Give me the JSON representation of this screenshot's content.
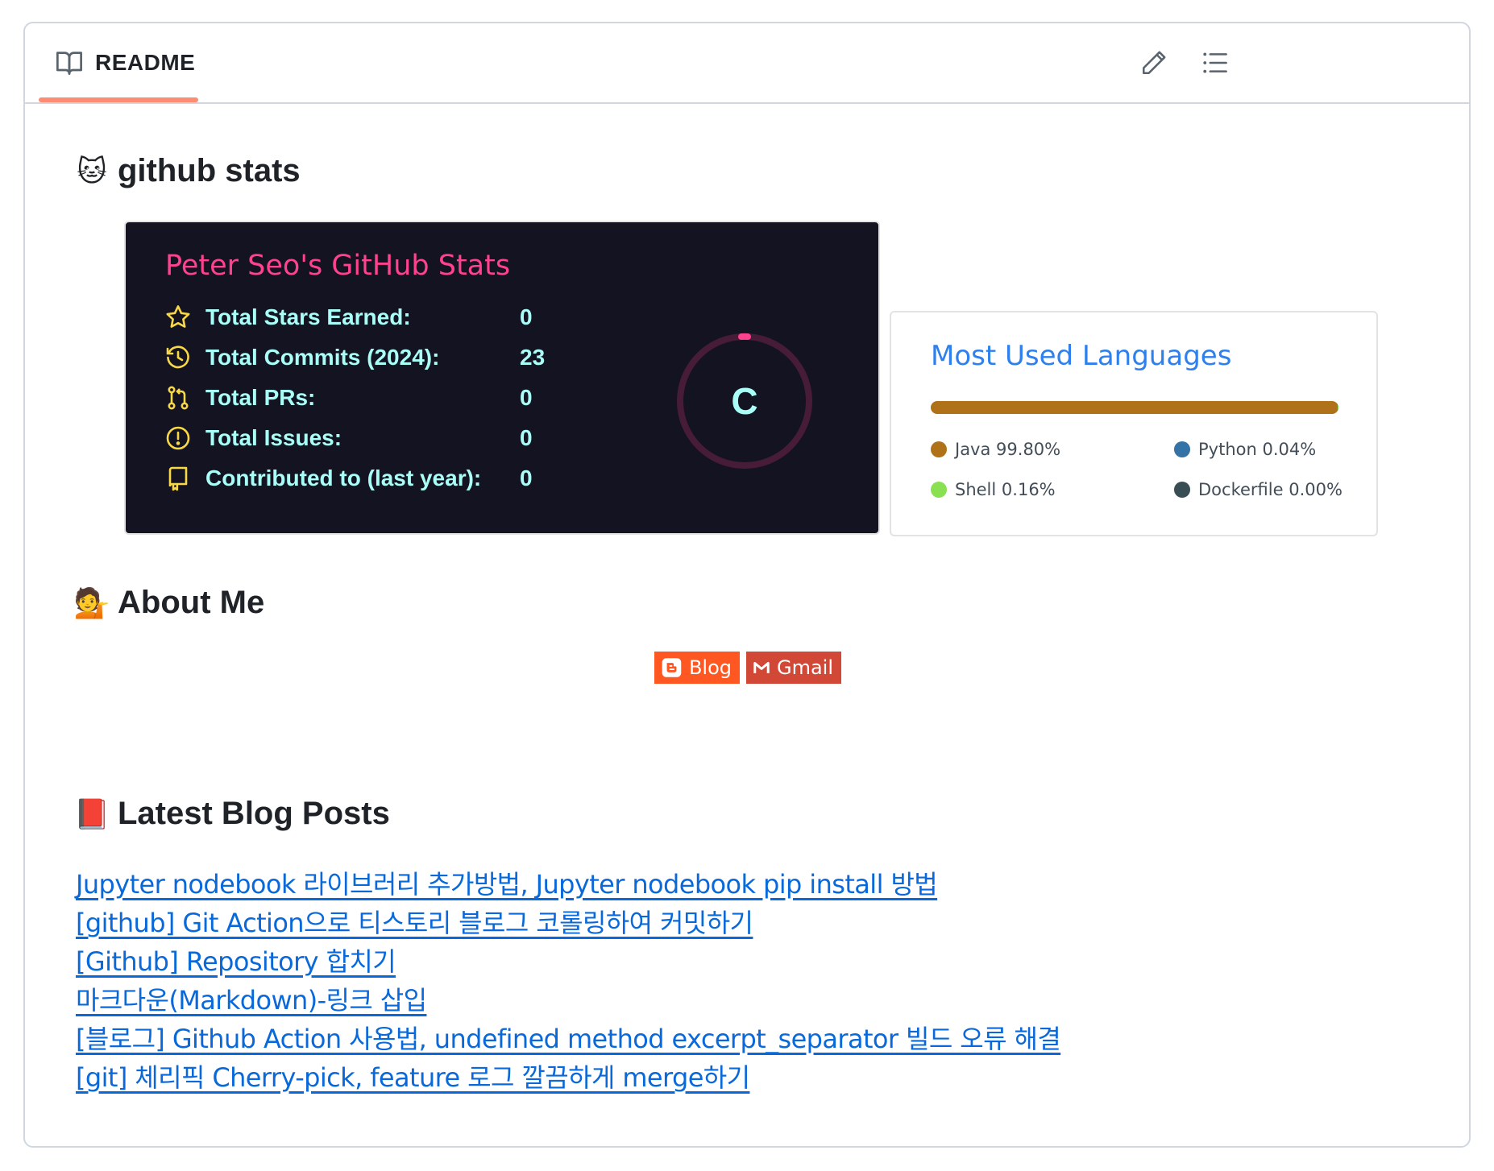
{
  "readme": {
    "tab_label": "README",
    "edit_icon": "pencil-icon",
    "outline_icon": "list-unordered-icon"
  },
  "sections": {
    "github_stats": {
      "emoji": "🐱",
      "title": "github stats"
    },
    "about_me": {
      "emoji": "💁",
      "title": "About Me"
    },
    "blog_posts": {
      "emoji": "📕",
      "title": "Latest Blog Posts"
    }
  },
  "stats_card": {
    "title": "Peter Seo's GitHub Stats",
    "rows": [
      {
        "icon": "star-icon",
        "label": "Total Stars Earned:",
        "value": "0"
      },
      {
        "icon": "history-icon",
        "label": "Total Commits (2024):",
        "value": "23"
      },
      {
        "icon": "pull-request-icon",
        "label": "Total PRs:",
        "value": "0"
      },
      {
        "icon": "issue-icon",
        "label": "Total Issues:",
        "value": "0"
      },
      {
        "icon": "repo-icon",
        "label": "Contributed to (last year):",
        "value": "0"
      }
    ],
    "rank": "C",
    "colors": {
      "bg": "#141321",
      "title": "#fe428e",
      "text": "#a9fef7",
      "icon": "#f8d847",
      "ring": "#fe428e"
    }
  },
  "languages_card": {
    "title": "Most Used Languages",
    "languages": [
      {
        "name": "Java",
        "percent": "99.80%",
        "share": 99.8,
        "color": "#b07219"
      },
      {
        "name": "Python",
        "percent": "0.04%",
        "share": 0.04,
        "color": "#3572A5"
      },
      {
        "name": "Shell",
        "percent": "0.16%",
        "share": 0.16,
        "color": "#89e051"
      },
      {
        "name": "Dockerfile",
        "percent": "0.00%",
        "share": 0.0,
        "color": "#384d54"
      }
    ]
  },
  "badges": [
    {
      "label": "Blog",
      "icon": "blogger-icon",
      "color": "#ff5722"
    },
    {
      "label": "Gmail",
      "icon": "gmail-icon",
      "color": "#d14836"
    }
  ],
  "blog_posts": [
    "Jupyter nodebook 라이브러리 추가방법, Jupyter nodebook pip install 방법",
    "[github] Git Action으로 티스토리 블로그 코롤링하여 커밋하기",
    "[Github] Repository 합치기",
    "마크다운(Markdown)-링크 삽입",
    "[블로그] Github Action 사용법, undefined method excerpt_separator 빌드 오류 해결",
    "[git] 체리픽 Cherry-pick, feature 로그 깔끔하게 merge하기"
  ]
}
